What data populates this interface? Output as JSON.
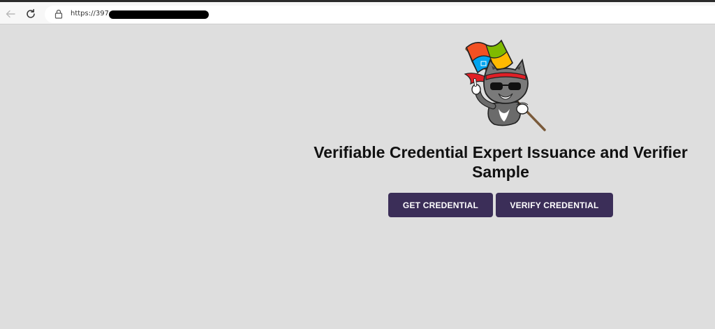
{
  "browser": {
    "url": "https://397c",
    "back_icon": "arrow-left-icon",
    "reload_icon": "reload-icon",
    "lock_icon": "lock-icon"
  },
  "page": {
    "logo": "ninja-cat-with-windows-flag",
    "title": "Verifiable Credential Expert Issuance and Verifier Sample",
    "buttons": {
      "get_credential": "GET CREDENTIAL",
      "verify_credential": "VERIFY CREDENTIAL"
    }
  },
  "colors": {
    "page_background": "#dedede",
    "button_background": "#3b2e58",
    "button_text": "#ffffff",
    "title_text": "#111111"
  }
}
